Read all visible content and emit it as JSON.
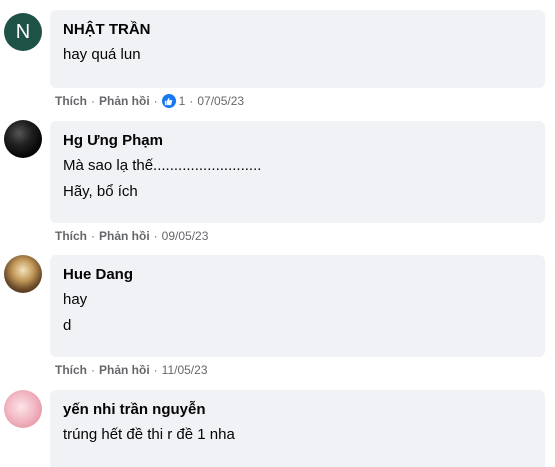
{
  "comments": [
    {
      "author": "NHẬT TRẦN",
      "avatar_letter": "N",
      "lines": [
        "hay quá lun"
      ],
      "like_label": "Thích",
      "reply_label": "Phản hồi",
      "reaction_count": "1",
      "date": "07/05/23"
    },
    {
      "author": "Hg Ưng Phạm",
      "lines": [
        "Mà sao lạ thế..........................",
        "Hãy, bổ ích"
      ],
      "like_label": "Thích",
      "reply_label": "Phản hồi",
      "date": "09/05/23"
    },
    {
      "author": "Hue Dang",
      "lines": [
        "hay",
        "d"
      ],
      "like_label": "Thích",
      "reply_label": "Phản hồi",
      "date": "11/05/23"
    },
    {
      "author": "yến nhi trần nguyễn",
      "lines": [
        "trúng hết đề thi r đề 1 nha"
      ]
    }
  ],
  "colors": {
    "bubble_bg": "#f0f2f5",
    "meta_text": "#65676b",
    "like_badge": "#1877f2",
    "avatar_letter_bg": "#1e5247"
  },
  "icons": {
    "reaction": "thumbs-up-icon"
  }
}
